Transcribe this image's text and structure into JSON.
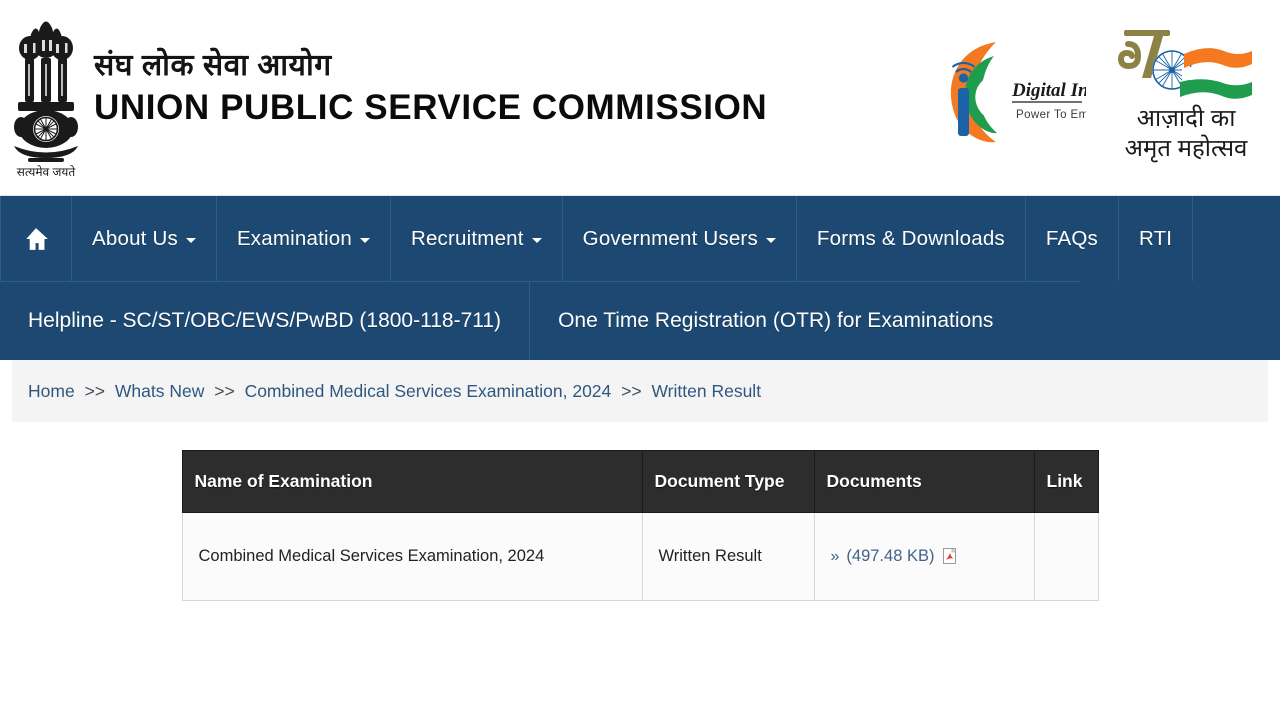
{
  "header": {
    "emblem_caption": "सत्यमेव जयते",
    "title_hi": "संघ लोक सेवा आयोग",
    "title_en": "UNION PUBLIC SERVICE COMMISSION",
    "digital_india": {
      "name": "Digital India",
      "tagline": "Power To Empower"
    },
    "azadi": {
      "numeral": "75",
      "line1": "आज़ादी का",
      "line2": "अमृत महोत्सव"
    }
  },
  "nav": {
    "primary": [
      {
        "label": "",
        "icon": "home-icon",
        "caret": false
      },
      {
        "label": "About Us",
        "caret": true
      },
      {
        "label": "Examination",
        "caret": true
      },
      {
        "label": "Recruitment",
        "caret": true
      },
      {
        "label": "Government Users",
        "caret": true
      },
      {
        "label": "Forms & Downloads",
        "caret": false
      },
      {
        "label": "FAQs",
        "caret": false
      },
      {
        "label": "RTI",
        "caret": false
      }
    ],
    "secondary": [
      {
        "label": "Helpline - SC/ST/OBC/EWS/PwBD (1800-118-711)"
      },
      {
        "label": "One Time Registration (OTR) for Examinations"
      }
    ]
  },
  "breadcrumb": {
    "items": [
      "Home",
      "Whats New",
      "Combined Medical Services Examination, 2024",
      "Written Result"
    ],
    "separator": ">>"
  },
  "table": {
    "headers": [
      "Name of Examination",
      "Document Type",
      "Documents",
      "Link"
    ],
    "rows": [
      {
        "name": "Combined Medical Services Examination, 2024",
        "doc_type": "Written Result",
        "documents_chevron": "»",
        "documents_size": "(497.48 KB)",
        "documents_icon": "pdf-icon",
        "link": ""
      }
    ]
  },
  "colors": {
    "nav_blue": "#1d4872",
    "nav_divider": "#2f5d89",
    "table_header_bg": "#2d2d2d",
    "link_blue": "#42628a",
    "crumb_blue": "#2f5880",
    "crumb_bg": "#f4f4f4",
    "saffron": "#f47920",
    "green": "#1f9c4d",
    "chakra_blue": "#1b62a8",
    "azadi_gold": "#8d8246",
    "pdf_red": "#d93a2b"
  }
}
